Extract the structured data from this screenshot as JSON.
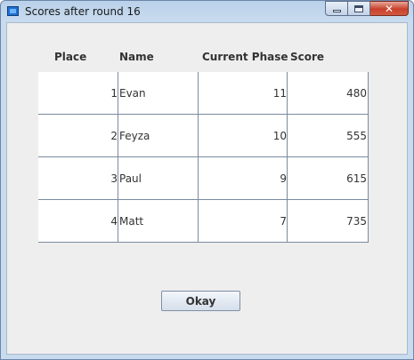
{
  "window": {
    "title": "Scores after round 16",
    "close_glyph": "✕"
  },
  "table": {
    "headers": [
      "Place",
      "Name",
      "Current Phase",
      "Score"
    ],
    "rows": [
      {
        "place": "1",
        "name": "Evan",
        "phase": "11",
        "score": "480"
      },
      {
        "place": "2",
        "name": "Feyza",
        "phase": "10",
        "score": "555"
      },
      {
        "place": "3",
        "name": "Paul",
        "phase": "9",
        "score": "615"
      },
      {
        "place": "4",
        "name": "Matt",
        "phase": "7",
        "score": "735"
      }
    ]
  },
  "footer": {
    "okay_label": "Okay"
  },
  "icons": {
    "app_icon": "app-icon",
    "minimize": "minimize-icon",
    "maximize": "maximize-icon",
    "close": "close-icon"
  },
  "colors": {
    "panel_background": "#eeeeee",
    "grid_line": "#7a8aa0",
    "close_button": "#c8412b"
  }
}
